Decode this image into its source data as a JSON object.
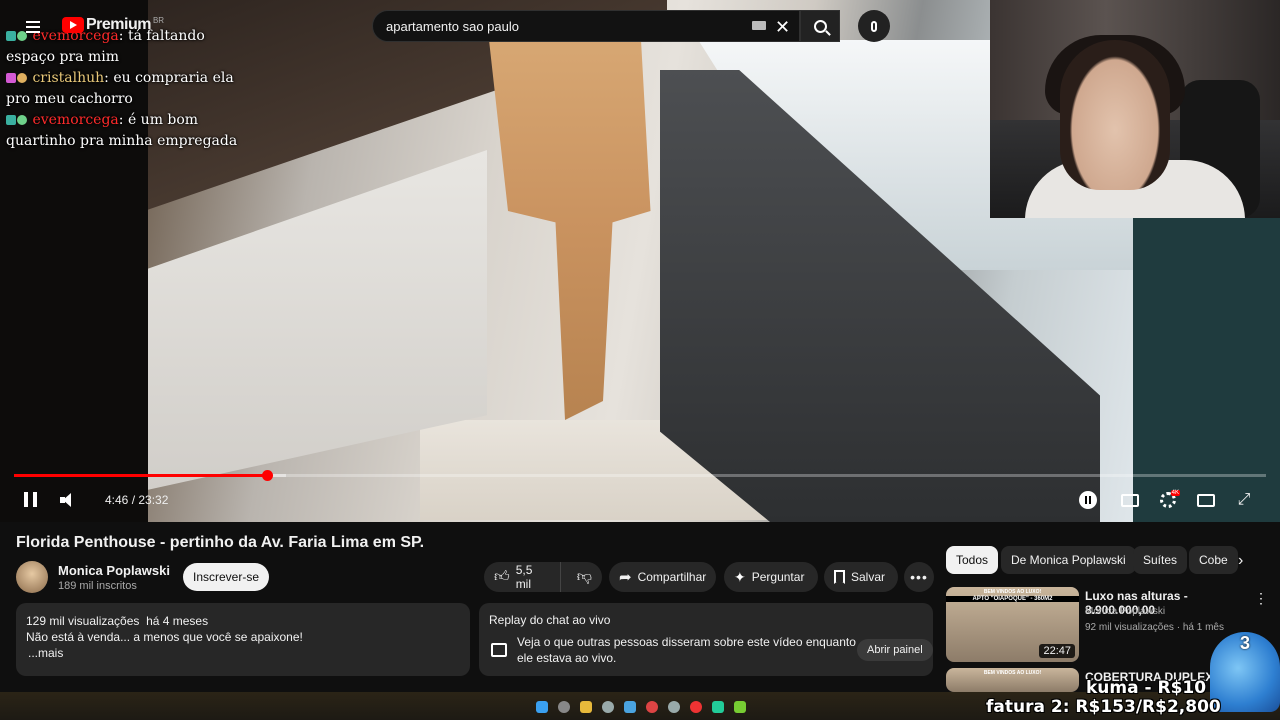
{
  "header": {
    "logo_text": "Premium",
    "logo_region": "BR",
    "search_value": "apartamento sao paulo"
  },
  "chat": [
    {
      "user": "evemorcega",
      "message": "tá faltando espaço pra mim",
      "user_color": "#ff2b2b"
    },
    {
      "user": "cristalhuh",
      "message": "eu compraria ela pro meu cachorro",
      "user_color": "#e8c879"
    },
    {
      "user": "evemorcega",
      "message": "é um bom quartinho pra minha empregada",
      "user_color": "#ff2b2b"
    }
  ],
  "player": {
    "current_time": "4:46",
    "duration": "23:32",
    "time_display": "4:46 / 23:32",
    "progress_fraction": 0.202,
    "buffered_fraction": 0.217
  },
  "video": {
    "title": "Florida Penthouse - pertinho da Av. Faria Lima em SP.",
    "channel": "Monica Poplawski",
    "subscribers": "189 mil inscritos",
    "subscribe_label": "Inscrever-se",
    "likes": "5,5 mil",
    "share_label": "Compartilhar",
    "ask_label": "Perguntar",
    "save_label": "Salvar"
  },
  "description": {
    "views": "129 mil visualizações",
    "age": "há 4 meses",
    "text": "Não está à venda... a menos que você se apaixone!",
    "more": "...mais"
  },
  "chat_replay": {
    "title": "Replay do chat ao vivo",
    "text": "Veja o que outras pessoas disseram sobre este vídeo enquanto ele estava ao vivo.",
    "button": "Abrir painel"
  },
  "chips": [
    "Todos",
    "De Monica Poplawski",
    "Suítes",
    "Cobe"
  ],
  "recommendations": [
    {
      "title": "Luxo nas alturas - 8.900.000,00",
      "channel": "Monica Poplawski",
      "views": "92 mil visualizações",
      "age": "há 1 mês",
      "duration": "22:47",
      "thumb_caption_1": "BEM VINDOS AO LUXO!",
      "thumb_caption_2": "APTO \"OIAPOQUE\" - 360M2"
    },
    {
      "title": "COBERTURA DUPLEX NO",
      "thumb_caption_1": "BEM VINDOS AO LUXO!"
    }
  ],
  "stream_overlay": {
    "goal_label": "kuma - R$10",
    "invoice": "fatura 2: R$153/R$2,800",
    "mascot_number": "3"
  },
  "colors": {
    "accent": "#ff0000",
    "background": "#0f0f0f",
    "surface": "#272727"
  }
}
